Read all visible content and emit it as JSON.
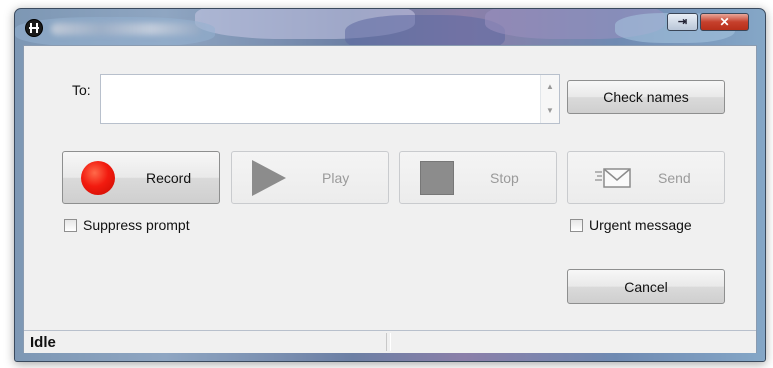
{
  "window": {
    "accent": "#7d97b4",
    "app_icon": "phone-icon",
    "restore_glyph": "⇥",
    "close_glyph": "✕"
  },
  "to": {
    "label": "To:",
    "value": "",
    "placeholder": ""
  },
  "buttons": {
    "check_names": "Check names",
    "record": "Record",
    "play": "Play",
    "stop": "Stop",
    "send": "Send",
    "cancel": "Cancel"
  },
  "icons": {
    "record": "record-icon",
    "play": "play-icon",
    "stop": "stop-icon",
    "send": "envelope-icon"
  },
  "options": {
    "suppress_prompt": "Suppress prompt",
    "suppress_checked": false,
    "urgent_message": "Urgent message",
    "urgent_checked": false
  },
  "status": {
    "left": "Idle",
    "right": ""
  },
  "colors": {
    "record_red": "#f21b0f",
    "disabled_gray": "#8c8c8c"
  }
}
